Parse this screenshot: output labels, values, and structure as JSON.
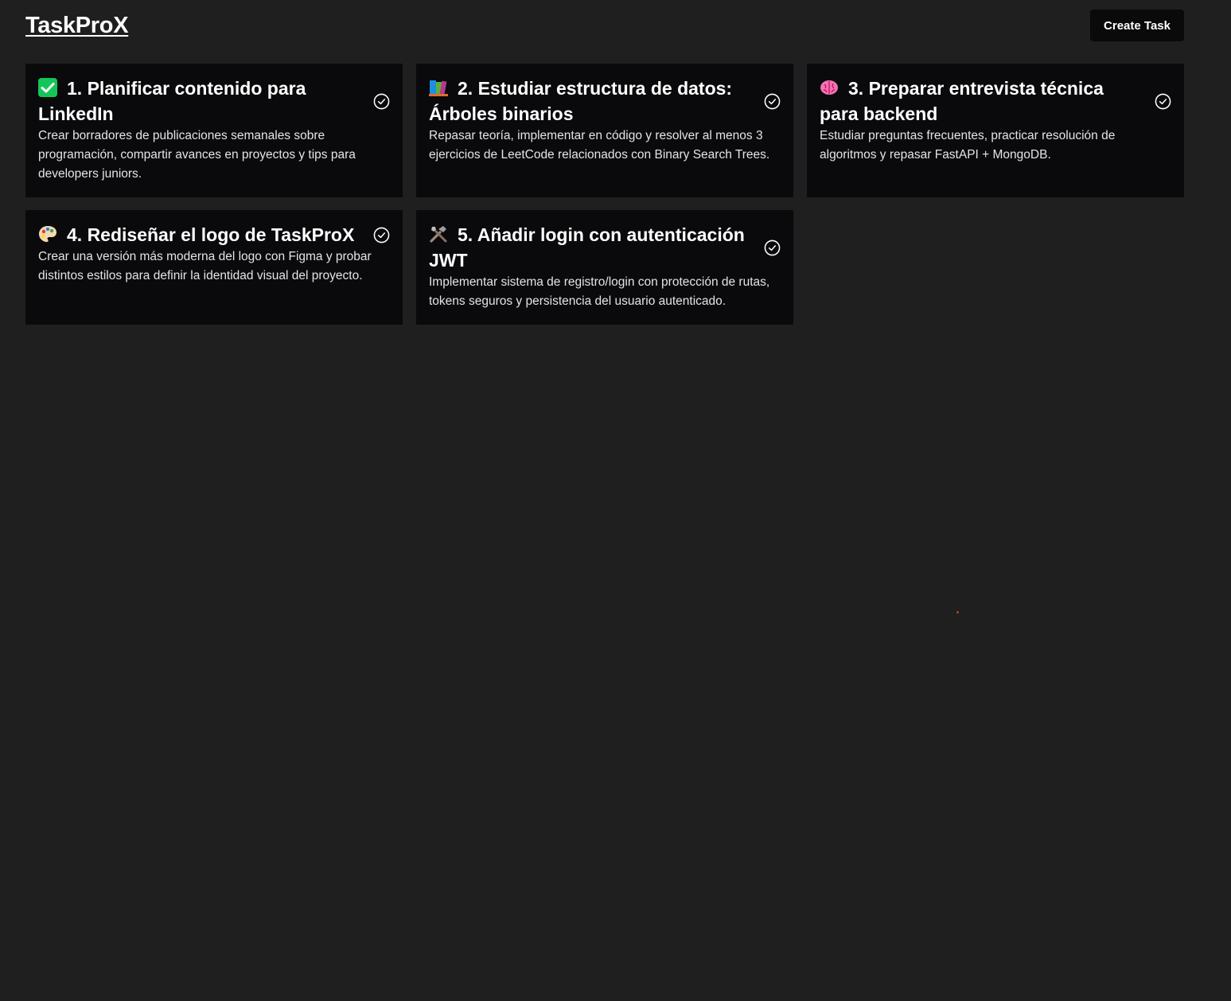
{
  "app": {
    "title": "TaskProX",
    "create_button_label": "Create Task"
  },
  "tasks": [
    {
      "icon": "checkmark-box-icon",
      "title": "1. Planificar contenido para LinkedIn",
      "description": "Crear borradores de publicaciones semanales sobre programación, compartir avances en proyectos y tips para developers juniors."
    },
    {
      "icon": "books-icon",
      "title": "2. Estudiar estructura de datos: Árboles binarios",
      "description": "Repasar teoría, implementar en código y resolver al menos 3 ejercicios de LeetCode relacionados con Binary Search Trees."
    },
    {
      "icon": "brain-icon",
      "title": "3. Preparar entrevista técnica para backend",
      "description": "Estudiar preguntas frecuentes, practicar resolución de algoritmos y repasar FastAPI + MongoDB."
    },
    {
      "icon": "palette-icon",
      "title": "4. Rediseñar el logo de TaskProX",
      "description": "Crear una versión más moderna del logo con Figma y probar distintos estilos para definir la identidad visual del proyecto."
    },
    {
      "icon": "tools-icon",
      "title": "5. Añadir login con autenticación JWT",
      "description": "Implementar sistema de registro/login con protección de rutas, tokens seguros y persistencia del usuario autenticado."
    }
  ],
  "colors": {
    "page_background": "#1f1f1f",
    "card_background": "#0a0a0c",
    "text": "#ffffff",
    "description_text": "#e4e4e4"
  }
}
